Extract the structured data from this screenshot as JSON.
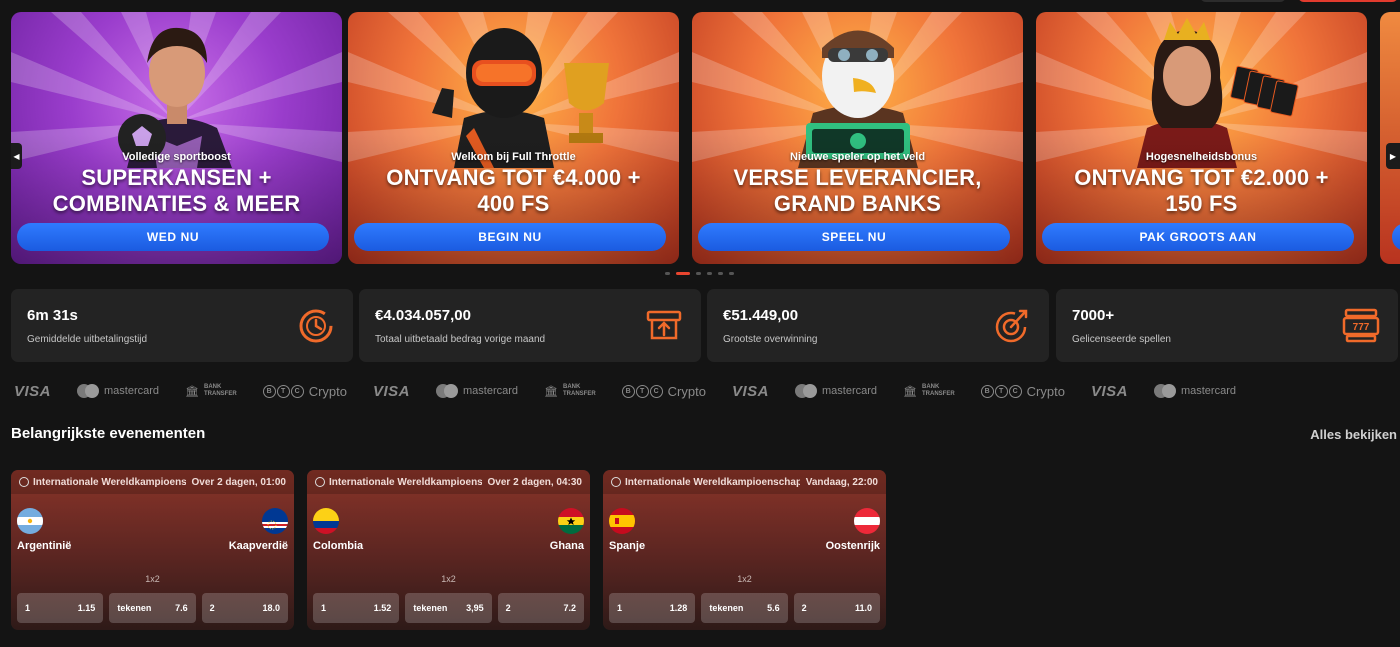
{
  "carousel": {
    "banners": [
      {
        "subtitle": "Volledige sportboost",
        "title_line1": "SUPERKANSEN +",
        "title_line2": "COMBINATIES & MEER",
        "button": "WED NU"
      },
      {
        "subtitle": "Welkom bij Full Throttle",
        "title_line1": "ONTVANG TOT €4.000 +",
        "title_line2": "400 FS",
        "button": "BEGIN NU"
      },
      {
        "subtitle": "Nieuwe speler op het veld",
        "title_line1": "VERSE LEVERANCIER,",
        "title_line2": "GRAND BANKS",
        "button": "SPEEL NU"
      },
      {
        "subtitle": "Hogesnelheidsbonus",
        "title_line1": "ONTVANG TOT €2.000 +",
        "title_line2": "150 FS",
        "button": "PAK GROOTS AAN"
      }
    ],
    "prev_icon": "chevron-left-icon",
    "next_icon": "chevron-right-icon",
    "active_dot": 2,
    "dot_count": 6
  },
  "stats": [
    {
      "value": "6m 31s",
      "label": "Gemiddelde uitbetalingstijd",
      "icon": "timer-icon"
    },
    {
      "value": "€4.034.057,00",
      "label": "Totaal uitbetaald bedrag vorige maand",
      "icon": "payout-icon"
    },
    {
      "value": "€51.449,00",
      "label": "Grootste overwinning",
      "icon": "target-icon"
    },
    {
      "value": "7000+",
      "label": "Gelicenseerde spellen",
      "icon": "slot-machine-icon"
    }
  ],
  "payments": {
    "visa": "VISA",
    "mastercard": "mastercard",
    "bank_line1": "BANK",
    "bank_line2": "TRANSFER",
    "btc": [
      "B",
      "T",
      "C"
    ],
    "crypto": "Crypto"
  },
  "events_section": {
    "title": "Belangrijkste evenementen",
    "see_all": "Alles bekijken"
  },
  "events": [
    {
      "competition": "Internationale Wereldkampioenschap",
      "time": "Over 2 dagen, 01:00",
      "home": "Argentinië",
      "away": "Kaapverdië",
      "market": "1x2",
      "odds": [
        {
          "label": "1",
          "value": "1.15"
        },
        {
          "label": "tekenen",
          "value": "7.6"
        },
        {
          "label": "2",
          "value": "18.0"
        }
      ]
    },
    {
      "competition": "Internationale Wereldkampioenschap",
      "time": "Over 2 dagen, 04:30",
      "home": "Colombia",
      "away": "Ghana",
      "market": "1x2",
      "odds": [
        {
          "label": "1",
          "value": "1.52"
        },
        {
          "label": "tekenen",
          "value": "3,95"
        },
        {
          "label": "2",
          "value": "7.2"
        }
      ]
    },
    {
      "competition": "Internationale Wereldkampioenschap",
      "time": "Vandaag, 22:00",
      "home": "Spanje",
      "away": "Oostenrijk",
      "market": "1x2",
      "odds": [
        {
          "label": "1",
          "value": "1.28"
        },
        {
          "label": "tekenen",
          "value": "5.6"
        },
        {
          "label": "2",
          "value": "11.0"
        }
      ]
    }
  ],
  "colors": {
    "accent": "#e8452f",
    "button_blue": "#1b5be0",
    "stat_icon": "#f06a2a"
  }
}
